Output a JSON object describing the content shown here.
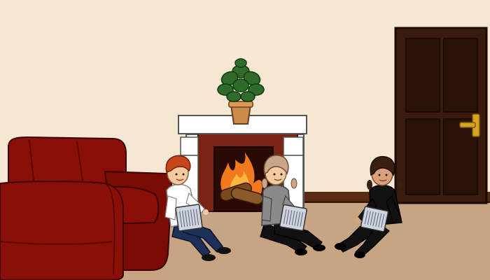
{
  "scene": {
    "description_icons": [
      "sofa-icon",
      "fireplace-icon",
      "fire-icon",
      "potted-plant-icon",
      "door-icon",
      "person-icon",
      "tablet-icon"
    ]
  },
  "colors": {
    "wall": "#f6e7d3",
    "floor": "#c7a582",
    "baseboard": "#5a2a12",
    "sofa": "#8a0f08",
    "sofa_dark": "#5e0603",
    "mantel": "#ffffff",
    "brick": "#7a2414",
    "door": "#3a1a0c",
    "door_panel": "#2b1208",
    "handle": "#d9a322",
    "plant_leaf": "#2f6b2a",
    "pot": "#c98a4a",
    "fire": "#f07a1d",
    "log": "#7a4a1e"
  }
}
